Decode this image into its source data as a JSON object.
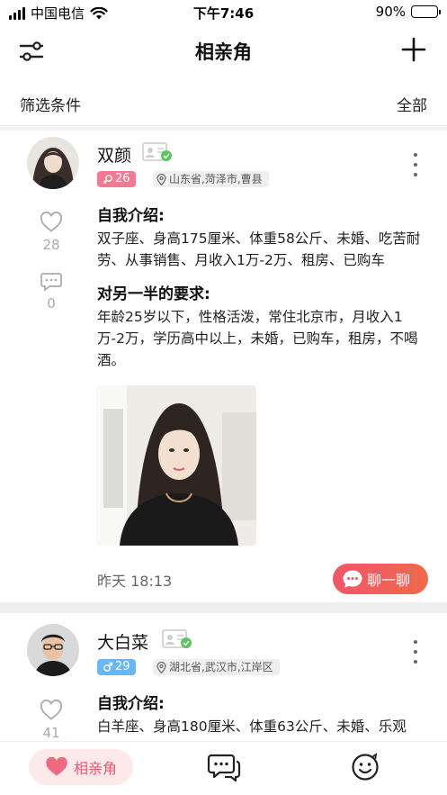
{
  "status_bar": {
    "carrier": "中国电信",
    "time": "下午7:46",
    "battery_text": "90%",
    "battery_level": 0.9
  },
  "nav": {
    "title": "相亲角",
    "filter_icon": "filter-sliders-icon",
    "add_icon": "plus-icon"
  },
  "filter": {
    "label": "筛选条件",
    "value": "全部"
  },
  "posts": [
    {
      "name": "双颜",
      "gender": "female",
      "age": "26",
      "location": "山东省,菏泽市,曹县",
      "likes": "28",
      "comments": "0",
      "intro_title": "自我介绍:",
      "intro": "双子座、身高175厘米、体重58公斤、未婚、吃苦耐劳、从事销售、月收入1万-2万、租房、已购车",
      "req_title": "对另一半的要求:",
      "req": "年龄25岁以下，性格活泼，常住北京市，月收入1万-2万，学历高中以上，未婚，已购车，租房，不喝酒。",
      "time": "昨天 18:13",
      "chat_label": "聊一聊",
      "accent_color": "#f07b92"
    },
    {
      "name": "大白菜",
      "gender": "male",
      "age": "29",
      "location": "湖北省,武汉市,江岸区",
      "likes": "41",
      "intro_title": "自我介绍:",
      "intro": "白羊座、身高180厘米、体重63公斤、未婚、乐观",
      "accent_color": "#6bb6f0"
    }
  ],
  "tabbar": {
    "home_label": "相亲角",
    "home_icon": "heart-icon",
    "messages_icon": "chat-bubbles-icon",
    "profile_icon": "smiley-icon",
    "active_color": "#ea5a6e"
  }
}
